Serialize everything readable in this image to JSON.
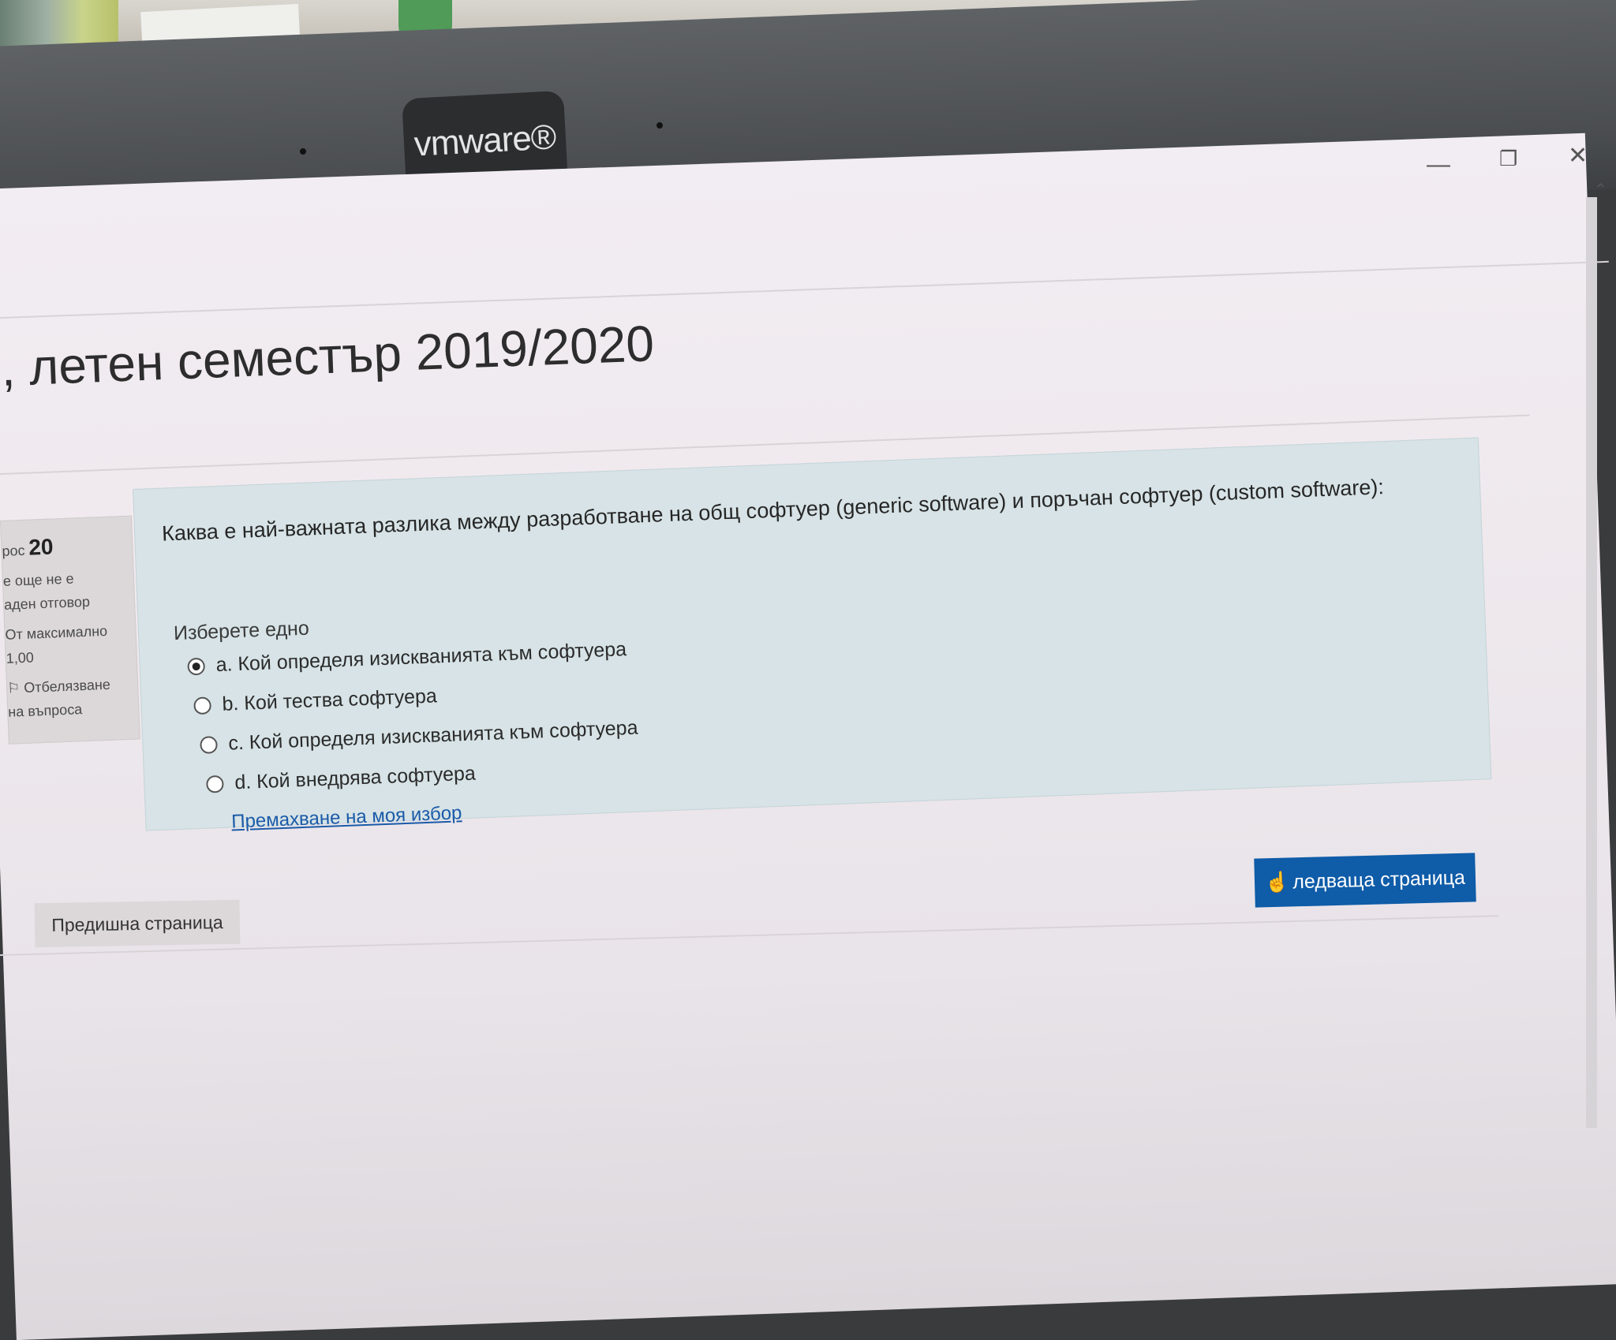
{
  "environment": {
    "brand_label": "vmware®"
  },
  "window_controls": {
    "minimize": "—",
    "restore": "❐",
    "close": "✕"
  },
  "page": {
    "title": ", летен семестър 2019/2020"
  },
  "question_info": {
    "number_prefix": "рос",
    "number": "20",
    "status_line1": "е още не е",
    "status_line2": "аден отговор",
    "max_points_line1": "От максимално",
    "max_points_line2": "1,00",
    "flag_line1": "Отбелязване",
    "flag_line2": "на въпроса"
  },
  "question": {
    "text": "Каква е най-важната разлика между разработване на общ софтуер (generic software) и поръчан софтуер (custom software):",
    "prompt": "Изберете едно",
    "options": [
      {
        "label": "a. Кой определя изискванията към софтуера",
        "selected": true
      },
      {
        "label": "b. Кой тества софтуера",
        "selected": false
      },
      {
        "label": "c. Кой определя изискванията към софтуера",
        "selected": false
      },
      {
        "label": "d. Кой внедрява софтуера",
        "selected": false
      }
    ],
    "clear_choice": "Премахване на моя избор"
  },
  "navigation": {
    "next": "ледваща страница",
    "prev": "Предишна страница"
  },
  "colors": {
    "question_bg": "#d7e3e6",
    "next_button": "#0f5ca8",
    "link": "#1a5aa8"
  }
}
